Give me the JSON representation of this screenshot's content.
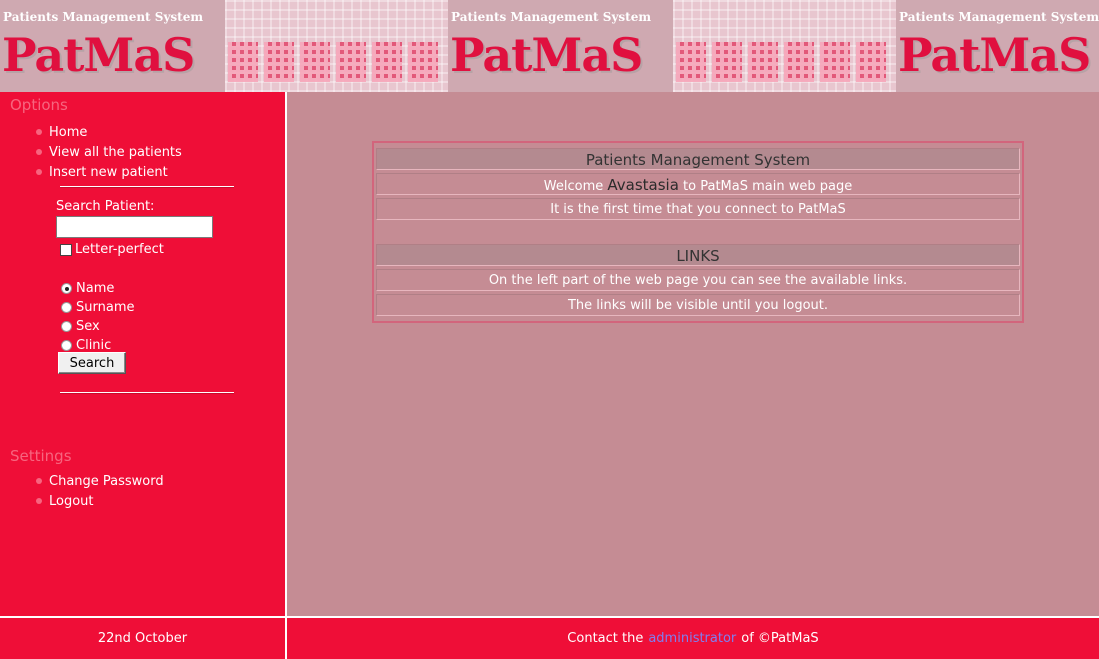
{
  "banner": {
    "subtitle": "Patients Management System",
    "logo": "PatMaS"
  },
  "sidebar": {
    "options_title": "Options",
    "options_items": [
      {
        "label": "Home"
      },
      {
        "label": "View all the patients"
      },
      {
        "label": "Insert new patient"
      }
    ],
    "search": {
      "label": "Search Patient:",
      "value": "",
      "placeholder": "",
      "checkbox_label": "Letter-perfect",
      "radio_options": [
        "Name",
        "Surname",
        "Sex",
        "Clinic"
      ],
      "selected": "Name",
      "button_label": "Search"
    },
    "settings_title": "Settings",
    "settings_items": [
      {
        "label": "Change Password"
      },
      {
        "label": "Logout"
      }
    ]
  },
  "main": {
    "title": "Patients Management System",
    "welcome_prefix": "Welcome",
    "user_name": "Avastasia",
    "welcome_suffix": "to PatMaS main web page",
    "first_time": "It is the first time that you connect to PatMaS",
    "links_title": "LINKS",
    "links_info_1": "On the left part of the web page you can see the available links.",
    "links_info_2": "The links will be visible until you logout."
  },
  "footer": {
    "date": "22nd October",
    "contact_prefix": "Contact the",
    "contact_link": "administrator",
    "contact_suffix": "of ©PatMaS"
  },
  "colors": {
    "sidebar": "#ef0e37",
    "main_bg": "#c58c94",
    "accent_bullet": "#f7657f"
  }
}
